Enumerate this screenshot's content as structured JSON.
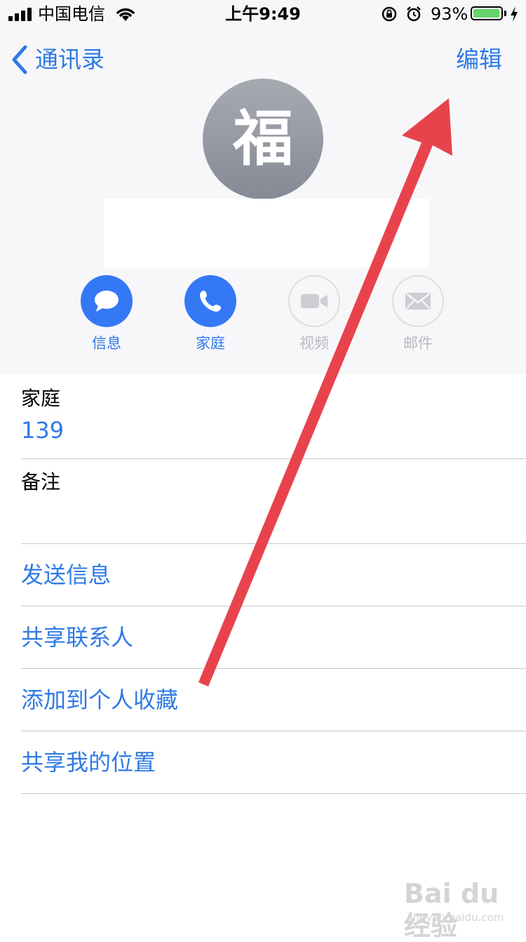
{
  "status_bar": {
    "carrier": "中国电信",
    "time": "上午9:49",
    "battery_percent": "93%",
    "battery_level": 0.93,
    "icons": [
      "signal-icon",
      "wifi-icon",
      "orientation-lock-icon",
      "alarm-icon",
      "battery-icon",
      "charging-icon"
    ]
  },
  "nav": {
    "back_label": "通讯录",
    "edit_label": "编辑"
  },
  "contact": {
    "avatar_initial": "福"
  },
  "actions": [
    {
      "label": "信息",
      "icon": "message-icon",
      "enabled": true
    },
    {
      "label": "家庭",
      "icon": "phone-icon",
      "enabled": true
    },
    {
      "label": "视频",
      "icon": "video-icon",
      "enabled": false
    },
    {
      "label": "邮件",
      "icon": "mail-icon",
      "enabled": false
    }
  ],
  "fields": {
    "phone_label": "家庭",
    "phone_value": "139",
    "notes_label": "备注"
  },
  "links": [
    "发送信息",
    "共享联系人",
    "添加到个人收藏",
    "共享我的位置"
  ],
  "watermark": {
    "main": "Bai du 经验",
    "sub": "jingyan.baidu.com"
  },
  "colors": {
    "accent": "#2f7ae5",
    "action_active": "#3478f6",
    "annotation_arrow": "#e8434d",
    "battery": "#65d46a"
  }
}
